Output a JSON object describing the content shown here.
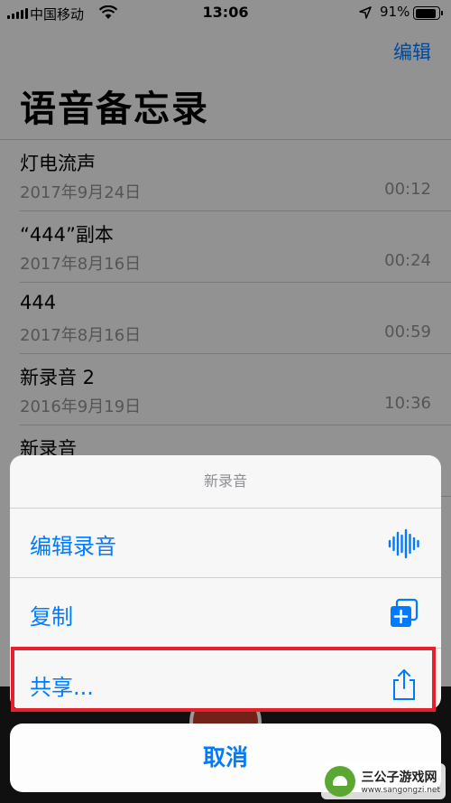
{
  "status_bar": {
    "carrier": "中国移动",
    "time": "13:06",
    "battery": "91%",
    "battery_level": 0.91
  },
  "header": {
    "edit_label": "编辑",
    "title": "语音备忘录"
  },
  "memos": [
    {
      "name": "灯电流声",
      "date": "2017年9月24日",
      "duration": "00:12"
    },
    {
      "name": "“444”副本",
      "date": "2017年8月16日",
      "duration": "00:24"
    },
    {
      "name": "444",
      "date": "2017年8月16日",
      "duration": "00:59"
    },
    {
      "name": "新录音 2",
      "date": "2016年9月19日",
      "duration": "10:36"
    },
    {
      "name": "新录音",
      "date": "",
      "duration": ""
    }
  ],
  "action_sheet": {
    "title": "新录音",
    "items": [
      {
        "label": "编辑录音",
        "icon": "waveform-icon"
      },
      {
        "label": "复制",
        "icon": "duplicate-icon"
      },
      {
        "label": "共享...",
        "icon": "share-icon"
      }
    ],
    "cancel_label": "取消"
  },
  "watermark": {
    "name": "三公子游戏网",
    "url": "www.sangongzi.net"
  },
  "colors": {
    "accent": "#007aff",
    "highlight": "#e8202a",
    "record": "#c0392b"
  }
}
